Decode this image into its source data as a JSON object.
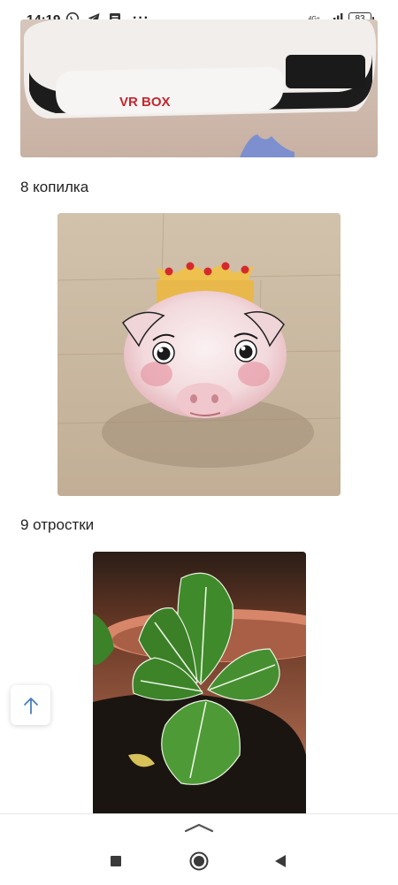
{
  "status_bar": {
    "time": "14:19",
    "network": "4G+",
    "battery": "83",
    "more": "···",
    "icons": [
      "whatsapp-icon",
      "telegram-icon",
      "message-icon",
      "signal-icon",
      "battery-icon"
    ]
  },
  "article": {
    "items": [
      {
        "caption": "",
        "image": "vr-box-headset-photo"
      },
      {
        "caption": "8 копилка",
        "image": "pig-piggy-bank-photo"
      },
      {
        "caption": "9 отростки",
        "image": "plant-sprouts-photo"
      }
    ],
    "vr_logo_text": "VR BOX"
  },
  "controls": {
    "scroll_top_icon": "arrow-up-icon"
  },
  "navigation": {
    "sheet_handle_icon": "chevron-up-icon",
    "buttons": [
      "recent-apps-icon",
      "home-icon",
      "back-icon"
    ]
  },
  "colors": {
    "accent": "#4a7fbf",
    "nav": "#3a3a3a"
  }
}
